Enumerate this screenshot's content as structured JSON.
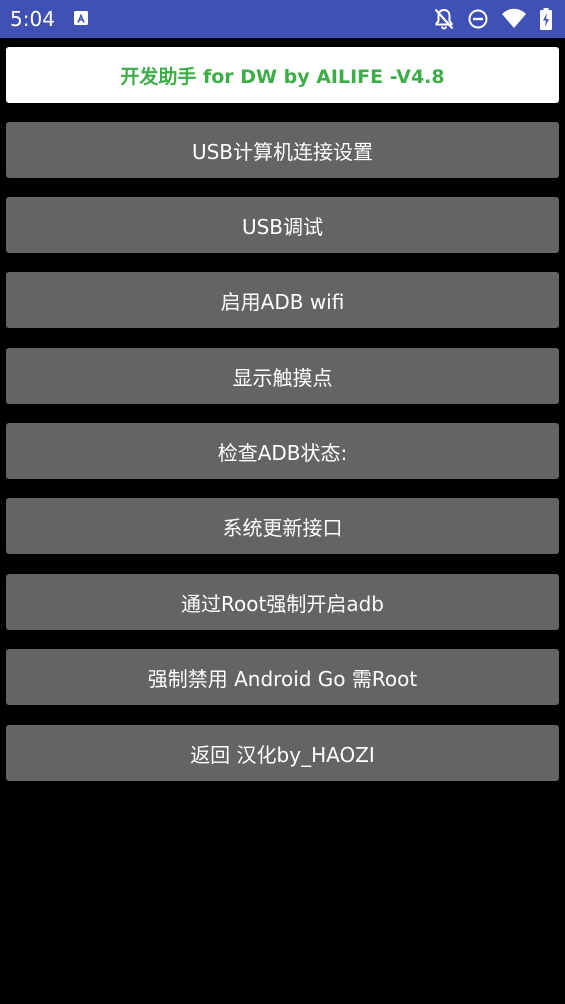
{
  "status_bar": {
    "time": "5:04",
    "notification_icon": "a-font-icon",
    "icons": [
      "bell-off-icon",
      "do-not-disturb-icon",
      "wifi-icon",
      "battery-charging-icon"
    ],
    "background_color": "#3f51b5"
  },
  "app": {
    "title": "开发助手 for DW by AILIFE -V4.8",
    "title_color": "#3cad47",
    "button_color": "#646464"
  },
  "menu": [
    {
      "label": "USB计算机连接设置"
    },
    {
      "label": "USB调试"
    },
    {
      "label": "启用ADB wifi"
    },
    {
      "label": "显示触摸点"
    },
    {
      "label": "检查ADB状态:"
    },
    {
      "label": "系统更新接口"
    },
    {
      "label": "通过Root强制开启adb"
    },
    {
      "label": "强制禁用 Android Go 需Root"
    },
    {
      "label": "返回 汉化by_HAOZI"
    }
  ]
}
